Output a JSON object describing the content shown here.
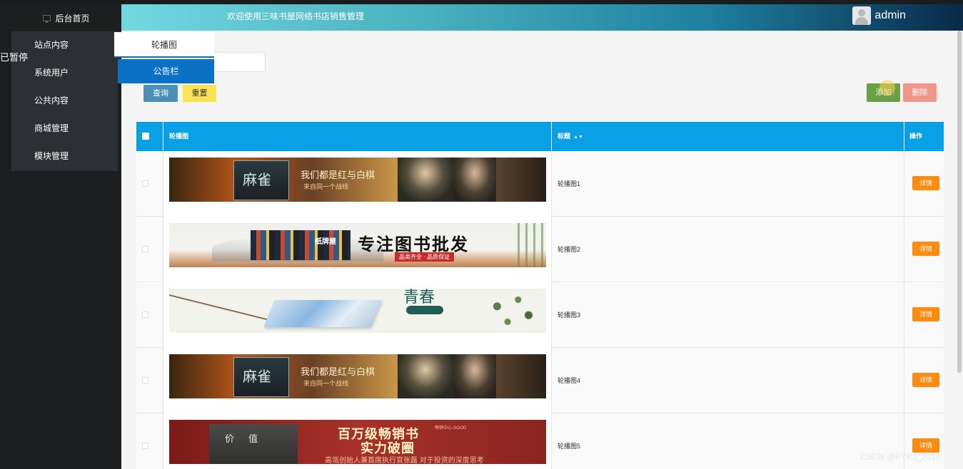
{
  "sidebar": {
    "home_label": "后台首页",
    "items": [
      {
        "label": "站点内容"
      },
      {
        "label": "系统用户"
      },
      {
        "label": "公共内容"
      },
      {
        "label": "商城管理"
      },
      {
        "label": "模块管理"
      }
    ],
    "paused_label": "已暂停"
  },
  "header": {
    "welcome": "欢迎使用三味书屋网络书店销售管理",
    "username": "admin"
  },
  "submenu": {
    "items": [
      {
        "label": "轮播图",
        "active": false
      },
      {
        "label": "公告栏",
        "active": true
      }
    ]
  },
  "toolbar": {
    "query_label": "查询",
    "reset_label": "重置",
    "add_label": "添加",
    "delete_label": "删除",
    "search_value": ""
  },
  "table": {
    "columns": {
      "image": "轮播图",
      "title": "标题",
      "actions": "操作"
    },
    "rows": [
      {
        "title": "轮播图1",
        "detail_label": "详情"
      },
      {
        "title": "轮播图2",
        "detail_label": "详情"
      },
      {
        "title": "轮播图3",
        "detail_label": "详情"
      },
      {
        "title": "轮播图4",
        "detail_label": "详情"
      },
      {
        "title": "轮播图5",
        "detail_label": "详情"
      }
    ]
  },
  "banners": {
    "b1": {
      "book_title": "麻雀",
      "caption": "我们都是红与白棋",
      "caption2": "来自同一个战线"
    },
    "b2": {
      "books_label": "纸牌屋",
      "slogan": "专注图书批发",
      "sub": "品类齐全 · 品质保证"
    },
    "b3": {
      "title": "青春"
    },
    "b5": {
      "book_title": "价值",
      "head": "百万级畅销书",
      "head2": "实力破圈",
      "tiny": "畅销中心·GOOD",
      "sub": "高瓴创始人兼首席执行官张磊 对于投资的深度思考"
    }
  },
  "watermark": "CSDN @FYKJ_2010",
  "colors": {
    "header_start": "#72d8e0",
    "header_end": "#0a2a48",
    "table_header": "#0aa0e6",
    "detail_button": "#fc8b0f",
    "add_button": "#6aa046",
    "delete_button": "#f3968a",
    "query_button": "#4a8fb8",
    "reset_button": "#fce356",
    "submenu_active": "#0a72c4"
  }
}
